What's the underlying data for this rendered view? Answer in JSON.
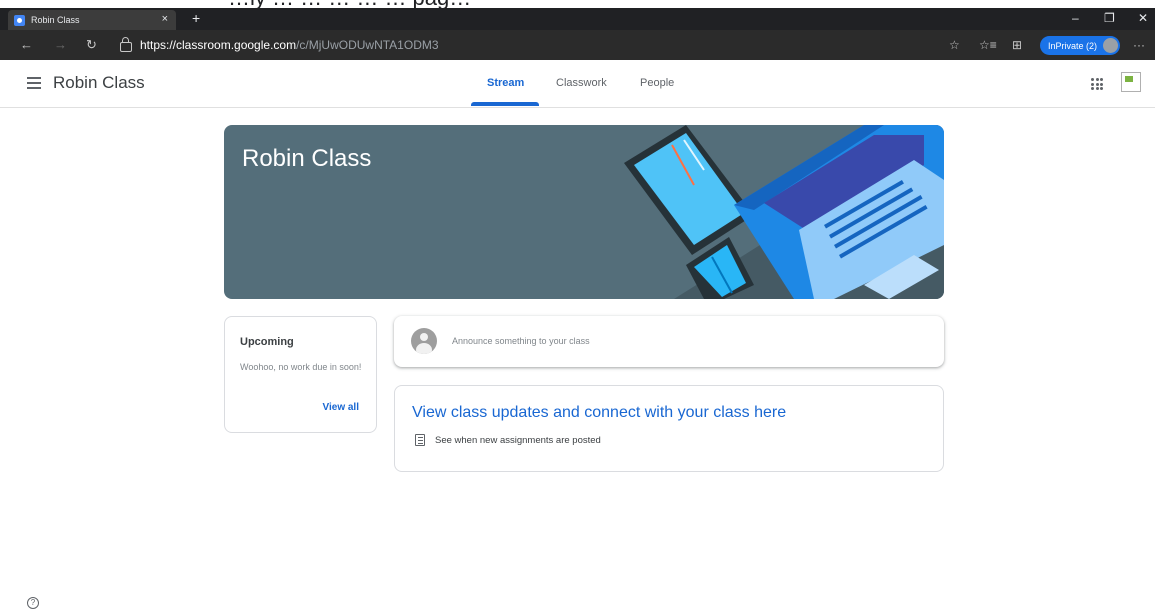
{
  "top_strip_text": "…ly … … … … … pag…",
  "browser": {
    "tab_title": "Robin Class",
    "tab_close": "×",
    "new_tab": "+",
    "window_controls": [
      "–",
      "❐",
      "✕"
    ],
    "nav": {
      "back": "←",
      "forward": "→",
      "refresh": "↻"
    },
    "url_host": "https://classroom.google.com",
    "url_path": "/c/MjUwODUwNTA1ODM3",
    "toolbar_icons": [
      "☆",
      "☆≡",
      "⊞"
    ],
    "inprivate_label": "InPrivate (2)",
    "more_label": "···"
  },
  "header": {
    "class_name": "Robin Class",
    "tabs": [
      {
        "label": "Stream",
        "active": true
      },
      {
        "label": "Classwork",
        "active": false
      },
      {
        "label": "People",
        "active": false
      }
    ]
  },
  "banner": {
    "title": "Robin Class",
    "color": "#546e7a"
  },
  "upcoming": {
    "title": "Upcoming",
    "text": "Woohoo, no work due in soon!",
    "link": "View all"
  },
  "announce": {
    "placeholder": "Announce something to your class"
  },
  "info": {
    "heading": "View class updates and connect with your class here",
    "item": "See when new assignments are posted"
  },
  "help_icon": "?",
  "colors": {
    "accent": "#1967d2",
    "banner": "#546e7a",
    "chrome_dark": "#202124"
  }
}
